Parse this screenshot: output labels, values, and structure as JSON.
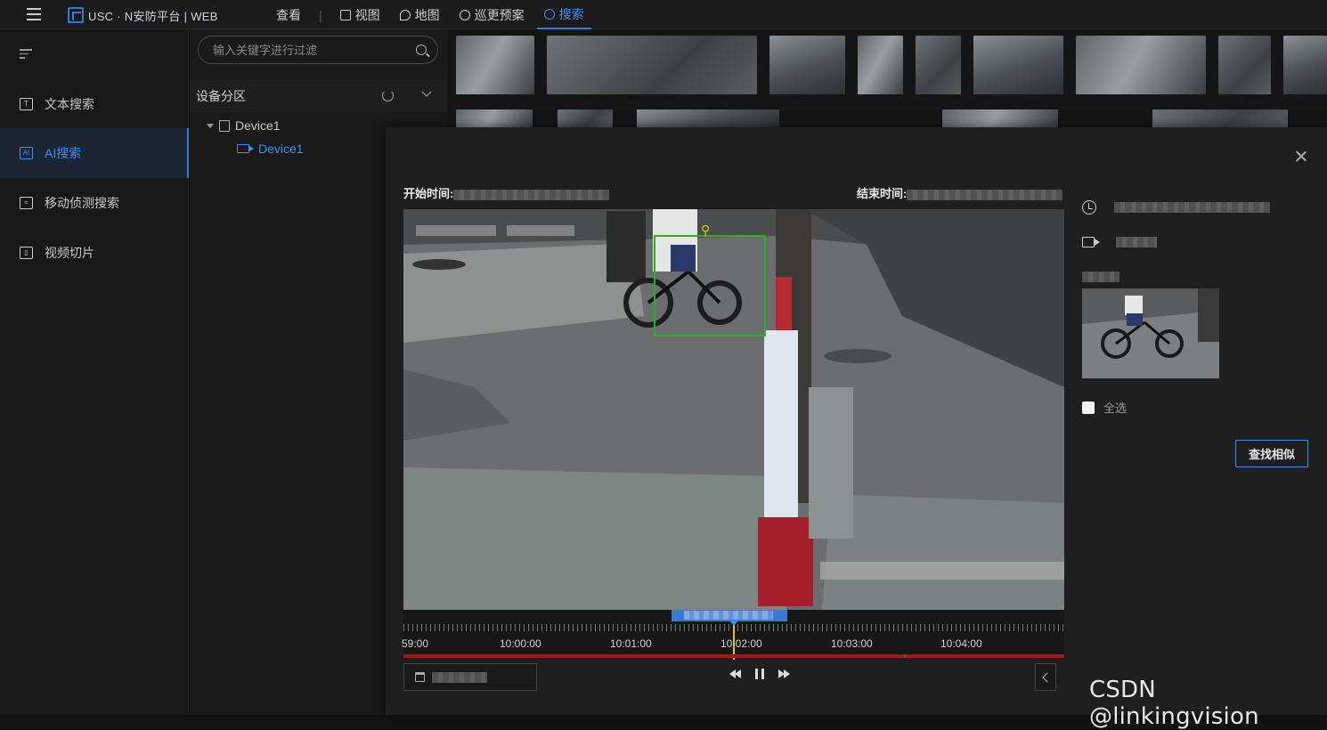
{
  "app": {
    "logo_text": "USC · N安防平台 | WEB"
  },
  "nav": {
    "items": [
      {
        "label": "查看"
      },
      {
        "label": "视图"
      },
      {
        "label": "地图"
      },
      {
        "label": "巡更预案"
      },
      {
        "label": "搜索"
      }
    ],
    "active": "搜索"
  },
  "sidebar": {
    "items": [
      {
        "label": "文本搜索",
        "icon": "text-search-icon"
      },
      {
        "label": "AI搜索",
        "icon": "ai-search-icon"
      },
      {
        "label": "移动侦测搜索",
        "icon": "motion-search-icon"
      },
      {
        "label": "视频切片",
        "icon": "video-slice-icon"
      }
    ],
    "active": "AI搜索"
  },
  "tree": {
    "filter_placeholder": "输入关键字进行过滤",
    "header": "设备分区",
    "device": "Device1",
    "camera": "Device1"
  },
  "modal": {
    "start_label": "开始时间:",
    "end_label": "结束时间:",
    "timeline_labels": [
      "59:00",
      "10:00:00",
      "10:01:00",
      "10:02:00",
      "10:03:00",
      "10:04:00"
    ],
    "select_all": "全选",
    "find_similar": "查找相似"
  },
  "watermark": "CSDN @linkingvision",
  "colors": {
    "accent": "#2f7fd8",
    "timeline_red": "#a51616",
    "bbox_green": "#27b327",
    "cursor_yellow": "#e0c400"
  }
}
